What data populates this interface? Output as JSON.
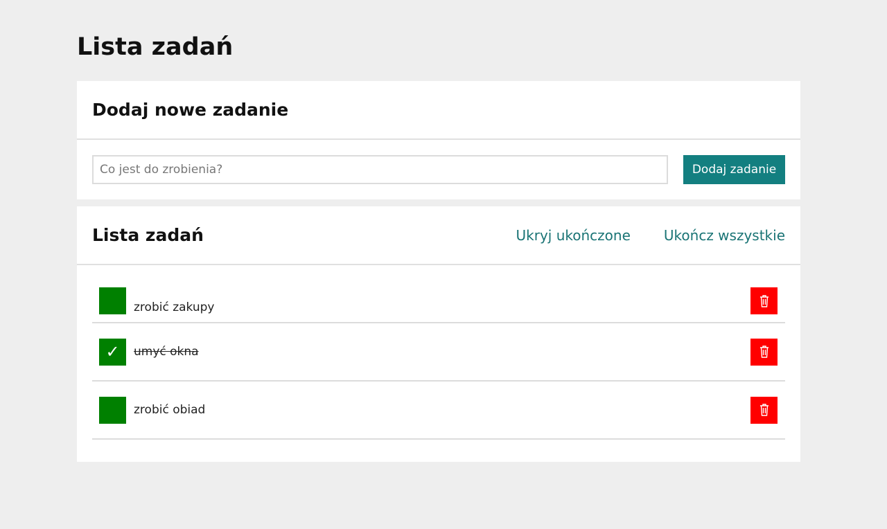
{
  "page": {
    "title": "Lista zadań"
  },
  "add_section": {
    "title": "Dodaj nowe zadanie",
    "input_value": "",
    "input_placeholder": "Co jest do zrobienia?",
    "add_button": "Dodaj zadanie"
  },
  "list_section": {
    "title": "Lista zadań",
    "hide_done_button": "Ukryj ukończone",
    "complete_all_button": "Ukończ wszystkie"
  },
  "tasks": [
    {
      "text": "zrobić zakupy",
      "done": false,
      "check_mark": ""
    },
    {
      "text": "umyć okna",
      "done": true,
      "check_mark": "✓"
    },
    {
      "text": "zrobić obiad",
      "done": false,
      "check_mark": ""
    }
  ],
  "colors": {
    "background": "#eeeeee",
    "accent": "#137f80",
    "link": "#1a7475",
    "check": "#008000",
    "delete": "#ff0000"
  },
  "icons": {
    "delete": "trash-icon",
    "check": "checkmark-icon"
  }
}
